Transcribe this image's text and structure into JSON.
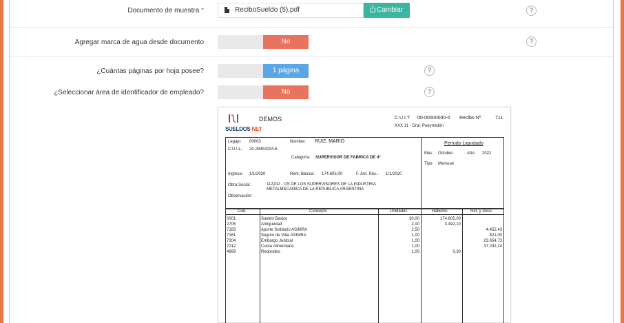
{
  "form": {
    "doc_sample": {
      "label": "Documento de muestra",
      "required_mark": "*",
      "file_name": "ReciboSueldo (5).pdf",
      "change_label": "Cambiar",
      "help": "?"
    },
    "watermark": {
      "label": "Agregar marca de agua desde documento",
      "value": "No",
      "help": "?"
    },
    "pages_per_sheet": {
      "label": "¿Cuántas páginas por hoja posee?",
      "value": "1 página",
      "help": "?"
    },
    "employee_area": {
      "label": "¿Seleccionar área de identificador de empleado?",
      "value": "No",
      "help": "?"
    }
  },
  "receipt": {
    "logo_text_a": "SUELDOS",
    "logo_text_b": "NET",
    "company": "DEMOS",
    "cuit_label": "C.U.I.T.",
    "cuit_value": "00-00000000-0",
    "recibo_label": "Recibo Nº",
    "recibo_value": "711",
    "address": "XXX 11 - Gral. Pueyrredón",
    "legajo_label": "Legajo:",
    "legajo_value": "00003",
    "nombre_label": "Nombre:",
    "nombre_value": "RUIZ, MARIO",
    "cuil_label": "C.U.I.L.:",
    "cuil_value": "20-28454204-6",
    "categoria_label": "Categoría:",
    "categoria_value": "SUPERVISOR DE FABRICA DE 4°",
    "ingreso_label": "Ingreso:",
    "ingreso_value": "1/1/2020",
    "rem_label": "Rem. Básica:",
    "rem_value": "174.605,00",
    "fant_label": "F. Ant. Rec.:",
    "fant_value": "1/1/2020",
    "obra_label": "Obra Social:",
    "obra_value_1": "112202 - OS  DE LOS SUPERVISORES DE LA INDUSTRIA",
    "obra_value_2": "METALMECANICA DE LA REPUBLICA ARGENTINA",
    "obs_label": "Observación:",
    "periodo_title": "Período Liquidado",
    "mes_label": "Mes:",
    "mes_value": "Octubre",
    "anio_label": "Año:",
    "anio_value": "2022",
    "tipo_label": "Tipo:",
    "tipo_value": "Mensual",
    "headers": {
      "cod": "Cod.",
      "concepto": "Concepto",
      "unidades": "Unidades",
      "haberes": "Haberes",
      "ret": "Ret. y Desc."
    },
    "rows": [
      {
        "cod": "0001",
        "concepto": "Sueldo Basico",
        "unidades": "30,00",
        "haberes": "174.605,00",
        "ret": ""
      },
      {
        "cod": "2705",
        "concepto": "Antiguedad",
        "unidades": "2,00",
        "haberes": "3.492,10",
        "ret": ""
      },
      {
        "cod": "7183",
        "concepto": "Aporte Solidario ASIMRA",
        "unidades": "2,50",
        "haberes": "",
        "ret": "4.452,43"
      },
      {
        "cod": "7181",
        "concepto": "Seguro de Vida ASIMRA",
        "unidades": "1,00",
        "haberes": "",
        "ret": "821,00"
      },
      {
        "cod": "7204",
        "concepto": "Embargo Judicial",
        "unidades": "1,00",
        "haberes": "",
        "ret": "23.654,73"
      },
      {
        "cod": "7212",
        "concepto": "Cuota Alimentaria",
        "unidades": "1,00",
        "haberes": "",
        "ret": "37.292,24"
      },
      {
        "cod": "4999",
        "concepto": "Redondeo",
        "unidades": "1,00",
        "haberes": "0,30",
        "ret": ""
      }
    ]
  }
}
